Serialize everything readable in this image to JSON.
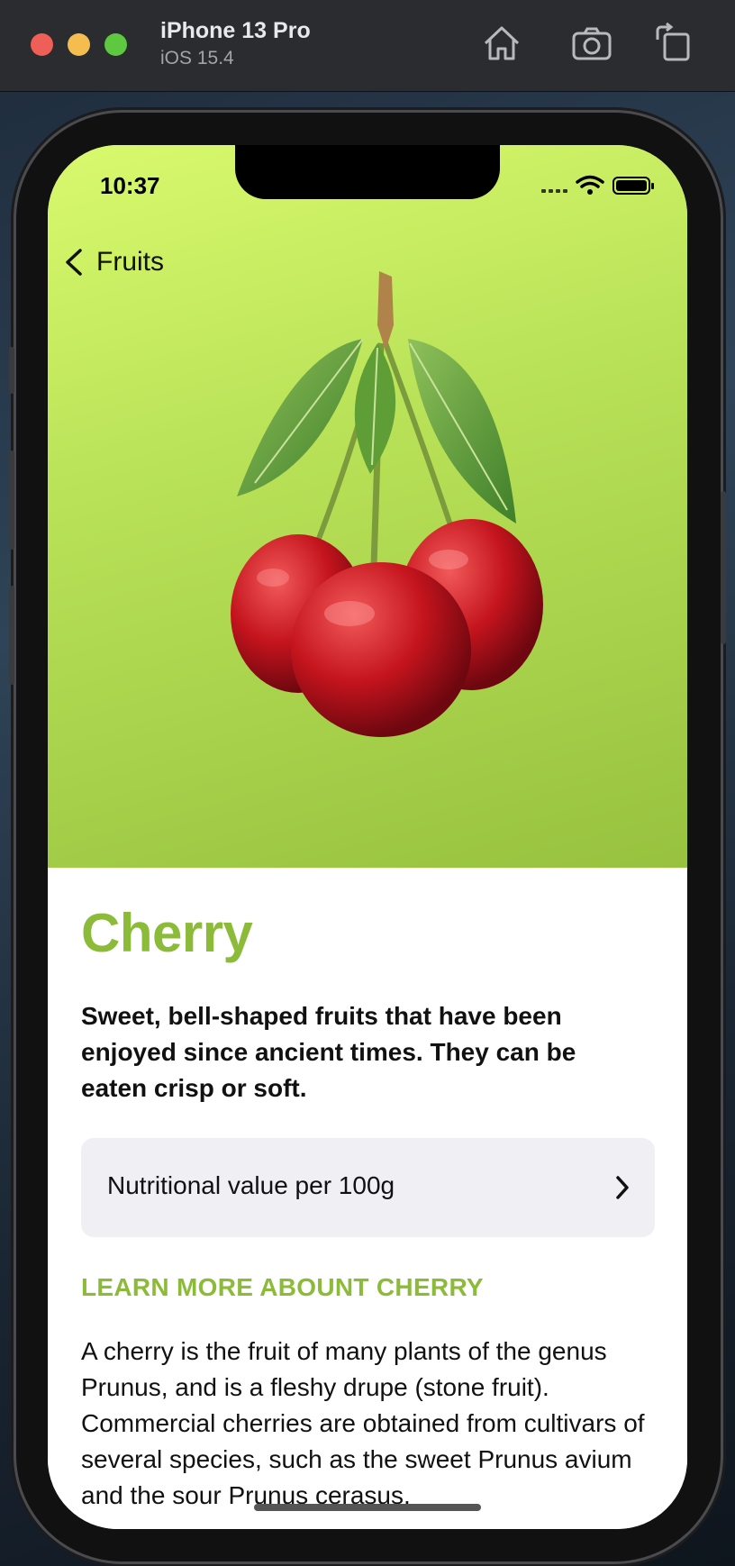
{
  "simulator": {
    "device_name": "iPhone 13 Pro",
    "os_version": "iOS 15.4",
    "toolbar_icons": [
      "home-icon",
      "screenshot-icon",
      "rotate-icon"
    ]
  },
  "status_bar": {
    "time": "10:37",
    "icons": [
      "signal-icon",
      "wifi-icon",
      "battery-icon"
    ]
  },
  "nav": {
    "back_label": "Fruits"
  },
  "fruit": {
    "name": "Cherry",
    "headline": "Sweet, bell-shaped fruits that have been enjoyed since ancient times. They can be eaten crisp or soft.",
    "nutrition_row_label": "Nutritional value per 100g",
    "learn_more_heading": "LEARN MORE ABOUNT CHERRY",
    "description": "A cherry is the fruit of many plants of the genus Prunus, and is a fleshy drupe (stone fruit). Commercial cherries are obtained from cultivars of several species, such as the sweet Prunus avium and the sour Prunus cerasus."
  },
  "colors": {
    "accent": "#8cbb3a",
    "gradient_light": "#d9f96d",
    "gradient_dark": "#97c23f",
    "row_background": "#efeff4"
  }
}
